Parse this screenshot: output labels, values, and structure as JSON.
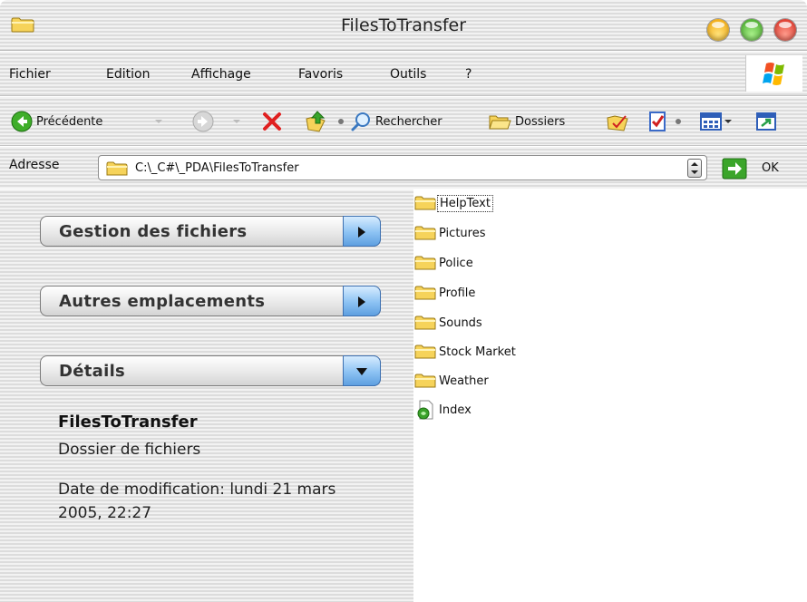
{
  "window": {
    "title": "FilesToTransfer",
    "controls": [
      "minimize",
      "zoom",
      "close"
    ]
  },
  "menu": {
    "items": [
      {
        "label": "Fichier"
      },
      {
        "label": "Edition"
      },
      {
        "label": "Affichage"
      },
      {
        "label": "Favoris"
      },
      {
        "label": "Outils"
      },
      {
        "label": "?"
      }
    ]
  },
  "toolbar": {
    "back_label": "Précédente",
    "search_label": "Rechercher",
    "folders_label": "Dossiers"
  },
  "address": {
    "label": "Adresse",
    "value": "C:\\_C#\\_PDA\\FilesToTransfer",
    "go_label": "OK"
  },
  "tasks": {
    "file_management": "Gestion des fichiers",
    "other_places": "Autres emplacements",
    "details": "Détails"
  },
  "details": {
    "name": "FilesToTransfer",
    "kind": "Dossier de fichiers",
    "modified": "Date de modification: lundi 21 mars 2005, 22:27"
  },
  "files": [
    {
      "name": "HelpText",
      "type": "folder"
    },
    {
      "name": "Pictures",
      "type": "folder"
    },
    {
      "name": "Police",
      "type": "folder"
    },
    {
      "name": "Profile",
      "type": "folder"
    },
    {
      "name": "Sounds",
      "type": "folder"
    },
    {
      "name": "Stock Market",
      "type": "folder"
    },
    {
      "name": "Weather",
      "type": "folder"
    },
    {
      "name": "Index",
      "type": "html-file"
    }
  ],
  "colors": {
    "accent_blue": "#5e9fe0",
    "folder_yellow": "#f6d35a",
    "close_red": "#d8261b",
    "minimize_yellow": "#f1a100",
    "zoom_green": "#3aa11e",
    "delete_red": "#e02020"
  }
}
